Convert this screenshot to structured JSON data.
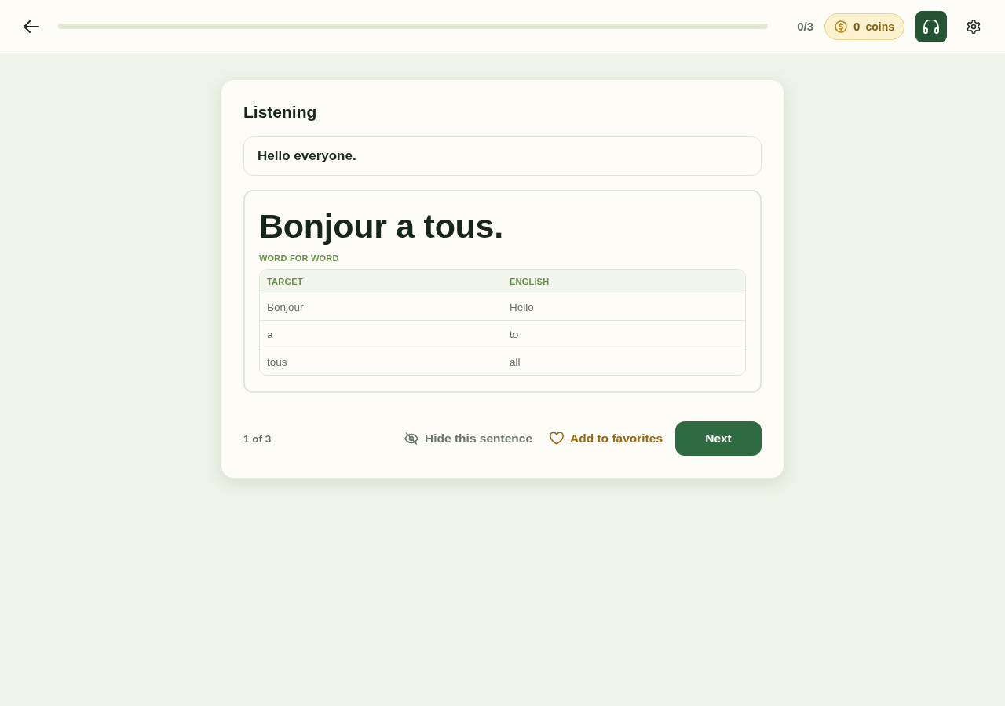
{
  "top_bar": {
    "progress": {
      "level": 0
    },
    "progress_text": "0/3",
    "coins": {
      "count": "0",
      "label": "coins"
    },
    "audio_button": {
      "on": true
    }
  },
  "card": {
    "title": "Listening",
    "prompt": "Hello everyone.",
    "answer": "Bonjour a tous.",
    "breakdown": {
      "heading": "WORD FOR WORD",
      "columns": [
        "TARGET",
        "ENGLISH"
      ],
      "rows": [
        [
          "Bonjour",
          "Hello"
        ],
        [
          "a",
          "to"
        ],
        [
          "tous",
          "all"
        ]
      ]
    },
    "footer": {
      "position": "1 of 3",
      "hide_link": "Hide this sentence",
      "favorite": {
        "label": "Add to favorites",
        "on": false
      },
      "next_button": "Next"
    }
  }
}
